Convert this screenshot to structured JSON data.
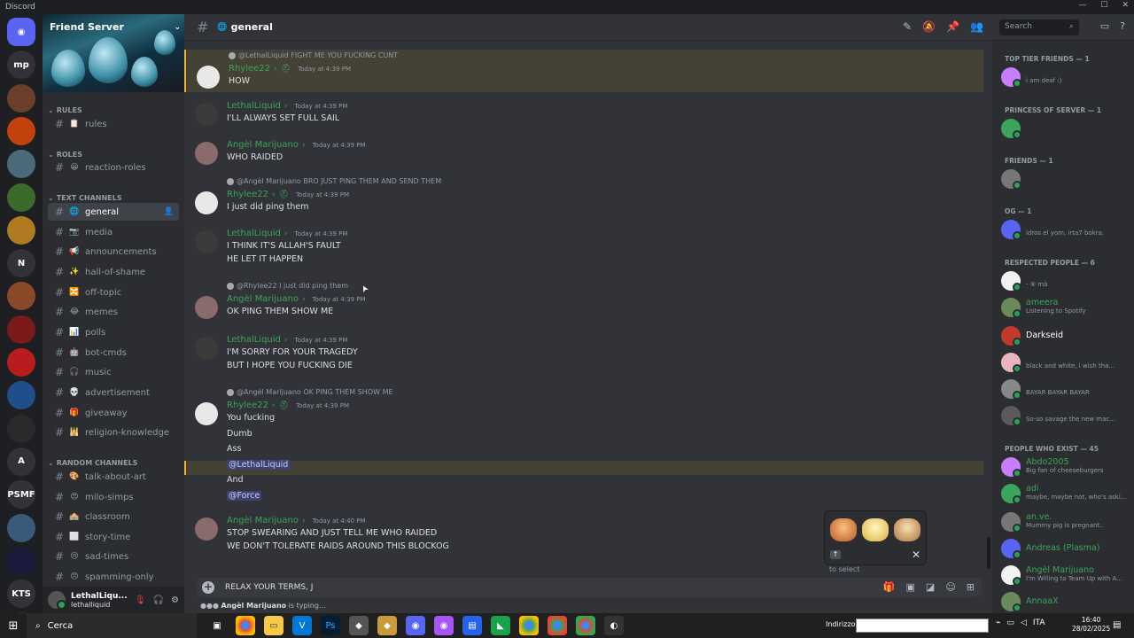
{
  "app": {
    "title": "Discord",
    "window_controls": [
      "—",
      "☐",
      "✕"
    ]
  },
  "servers": [
    {
      "label": "",
      "icon": "discord-logo-icon",
      "color": "#5865f2"
    },
    {
      "label": "mp",
      "color": "#313338"
    },
    {
      "label": "",
      "color": "#6b3f2a"
    },
    {
      "label": "",
      "color": "#c2410c"
    },
    {
      "label": "",
      "color": "#4a6a7a"
    },
    {
      "label": "",
      "color": "#3a6b2a"
    },
    {
      "label": "",
      "color": "#b07a20"
    },
    {
      "label": "N",
      "color": "#313338"
    },
    {
      "label": "",
      "color": "#8a4a2a"
    },
    {
      "label": "",
      "color": "#7a1a1a"
    },
    {
      "label": "",
      "color": "#b91c1c"
    },
    {
      "label": "",
      "color": "#1f4e8a"
    },
    {
      "label": "",
      "color": "#2a2a2a"
    },
    {
      "label": "A",
      "color": "#313338"
    },
    {
      "label": "PSMF",
      "color": "#313338"
    },
    {
      "label": "",
      "color": "#3a5a7a"
    },
    {
      "label": "",
      "color": "#1a1a3a"
    },
    {
      "label": "KTS",
      "color": "#313338"
    },
    {
      "label": "",
      "icon": "explore-icon",
      "color": "#313338"
    }
  ],
  "server": {
    "name": "Friend Server"
  },
  "categories": {
    "rules": "RULES",
    "roles": "ROLES",
    "text": "TEXT CHANNELS",
    "random": "RANDOM CHANNELS"
  },
  "channels": [
    {
      "name": "rules",
      "emoji": "📋"
    },
    {
      "name": "reaction-roles",
      "emoji": "😀"
    },
    {
      "name": "general",
      "emoji": "🌐"
    },
    {
      "name": "media",
      "emoji": "📷"
    },
    {
      "name": "announcements",
      "emoji": "📢"
    },
    {
      "name": "hall-of-shame",
      "emoji": "✨"
    },
    {
      "name": "off-topic",
      "emoji": "🔀"
    },
    {
      "name": "memes",
      "emoji": "😂"
    },
    {
      "name": "polls",
      "emoji": "📊"
    },
    {
      "name": "bot-cmds",
      "emoji": "🤖"
    },
    {
      "name": "music",
      "emoji": "🎧"
    },
    {
      "name": "advertisement",
      "emoji": "💀"
    },
    {
      "name": "giveaway",
      "emoji": "🎁"
    },
    {
      "name": "religion-knowledge",
      "emoji": "🕌"
    },
    {
      "name": "talk-about-art",
      "emoji": "🎨"
    },
    {
      "name": "milo-simps",
      "emoji": "😍"
    },
    {
      "name": "classroom",
      "emoji": "🏫"
    },
    {
      "name": "story-time",
      "emoji": "⬜"
    },
    {
      "name": "sad-times",
      "emoji": "😢"
    },
    {
      "name": "spamming-only",
      "emoji": "😠"
    }
  ],
  "user": {
    "name": "LethalLiqu...",
    "tag": "lethalliquid"
  },
  "header": {
    "channel": "general",
    "search_placeholder": "Search"
  },
  "messages": [
    {
      "reply": "@LethalLiquid FIGHT ME YOU FUCKING CUNT",
      "author": "Rhylee22",
      "color": "#3ba55c",
      "time": "Today at 4:39 PM",
      "lines": [
        "HOW"
      ],
      "highlight": true
    },
    {
      "author": "LethalLiquid",
      "color": "#3ba55c",
      "time": "Today at 4:39 PM",
      "lines": [
        "I'LL ALWAYS SET FULL SAIL"
      ]
    },
    {
      "author": "Angèl Marijuano",
      "color": "#3ba55c",
      "time": "Today at 4:39 PM",
      "lines": [
        "WHO RAIDED"
      ]
    },
    {
      "reply": "@Angèl Marijuano BRO JUST PING THEM AND SEND THEM",
      "author": "Rhylee22",
      "color": "#3ba55c",
      "time": "Today at 4:39 PM",
      "lines": [
        "I just did ping them"
      ]
    },
    {
      "author": "LethalLiquid",
      "color": "#3ba55c",
      "time": "Today at 4:39 PM",
      "lines": [
        "I THINK IT'S ALLAH'S FAULT",
        "HE LET IT HAPPEN"
      ]
    },
    {
      "reply": "@Rhylee22 I just did ping them",
      "author": "Angèl Marijuano",
      "color": "#3ba55c",
      "time": "Today at 4:39 PM",
      "lines": [
        "OK PING THEM SHOW ME"
      ]
    },
    {
      "author": "LethalLiquid",
      "color": "#3ba55c",
      "time": "Today at 4:39 PM",
      "lines": [
        "I'M SORRY FOR YOUR TRAGEDY",
        "BUT I HOPE YOU FUCKING DIE"
      ]
    },
    {
      "reply": "@Angèl Marijuano OK PING THEM SHOW ME",
      "author": "Rhylee22",
      "color": "#3ba55c",
      "time": "Today at 4:39 PM",
      "lines": [
        "You fucking",
        "Dumb",
        "Ass",
        "@LethalLiquid",
        "And",
        "@Force"
      ]
    },
    {
      "author": "Angèl Marijuano",
      "color": "#3ba55c",
      "time": "Today at 4:40 PM",
      "lines": [
        "STOP SWEARING AND JUST TELL ME WHO RAIDED",
        "WE DON'T TOLERATE RAIDS AROUND THIS BLOCKOG"
      ]
    }
  ],
  "composer": {
    "value": "RELAX YOUR TERMS, J"
  },
  "typing": {
    "user": "Angèl Marijuano",
    "text": " is typing..."
  },
  "popup": {
    "select_text": "to select"
  },
  "member_groups": [
    {
      "label": "TOP TIER FRIENDS — 1",
      "members": [
        {
          "name": "",
          "status": "i am deaf :)",
          "color": "#f23f43"
        }
      ]
    },
    {
      "label": "PRINCESS OF SERVER — 1",
      "members": [
        {
          "name": "",
          "status": "",
          "color": "#3ba55c"
        }
      ]
    },
    {
      "label": "FRIENDS — 1",
      "members": [
        {
          "name": "",
          "status": "",
          "color": "#5865f2"
        }
      ]
    },
    {
      "label": "OG — 1",
      "members": [
        {
          "name": "",
          "status": "idros el yom, irta7 bokra.",
          "color": "#3ba55c"
        }
      ]
    },
    {
      "label": "RESPECTED PEOPLE — 6",
      "members": [
        {
          "name": "",
          "status": "- ⑧ mä",
          "color": "#dbdee1"
        },
        {
          "name": "ameera",
          "status": "Listening to Spotify",
          "color": "#3ba55c"
        },
        {
          "name": "Darkseid",
          "status": "",
          "color": "#ffffff"
        },
        {
          "name": "",
          "status": "black and white, i wish tha...",
          "color": "#3ba55c"
        },
        {
          "name": "",
          "status": "BAYAR BAYAR BAYAR",
          "color": "#5865f2"
        },
        {
          "name": "",
          "status": "So-so savage the new mac...",
          "color": "#3ba55c"
        }
      ]
    },
    {
      "label": "PEOPLE WHO EXIST — 45",
      "members": [
        {
          "name": "Abdo2005",
          "status": "Big fan of cheeseburgers",
          "color": "#3ba55c"
        },
        {
          "name": "adi",
          "status": "maybe, maybe not, who's aski...",
          "color": "#3ba55c"
        },
        {
          "name": "an.ve.",
          "status": "Mummy pig is pregnant..",
          "color": "#3ba55c"
        },
        {
          "name": "Andreas (Plasma)",
          "status": "",
          "color": "#3ba55c"
        },
        {
          "name": "Angèl Marijuano",
          "status": "I'm Willing to Team Up with A...",
          "color": "#3ba55c"
        },
        {
          "name": "AnnaaX",
          "status": "",
          "color": "#3ba55c"
        }
      ]
    }
  ],
  "taskbar": {
    "search": "Cerca",
    "address_label": "Indirizzo",
    "time": "16:40",
    "date": "28/02/2025",
    "lang": "ITA"
  }
}
